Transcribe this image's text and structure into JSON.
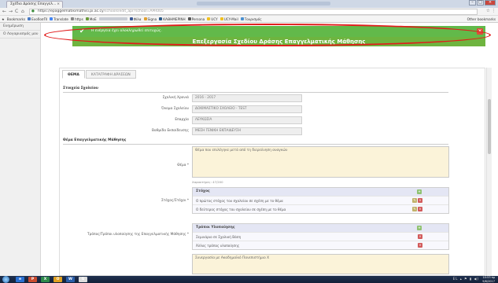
{
  "browser": {
    "tab_title": "Σχέδιο Δράσης Επαγγελ…",
    "tab_close": "×",
    "url_host": "https://epaggelmatikimathisi.pi.ac.cy",
    "url_rest": "/schools/edit_apr?school=APR005",
    "nav_back": "←",
    "nav_forward": "→",
    "nav_reload": "C",
    "nav_home": "⌂",
    "star_icon": "☆",
    "menu_icon": "⋮",
    "bookmarks_bar_label": "Bookmarks",
    "bookmarks": [
      {
        "label": "ΕυοδοσΠΙ",
        "color": "#4a7bc4"
      },
      {
        "label": "Translate",
        "color": "#4285f4"
      },
      {
        "label": "https",
        "color": "#888888"
      },
      {
        "label": "MoE",
        "color": "#6a9a3a"
      },
      {
        "label": "Φίλα",
        "color": "#3b5998"
      },
      {
        "label": "Signa",
        "color": "#e0a030"
      },
      {
        "label": "ΚΑΘΗΜΕΡΙΝΗ",
        "color": "#2a5a8a"
      },
      {
        "label": "Persona",
        "color": "#555555"
      },
      {
        "label": "UCY",
        "color": "#f0c020"
      },
      {
        "label": "UCY-Mail",
        "color": "#f0c020"
      },
      {
        "label": "Τουρισμός",
        "color": "#4a90d0"
      }
    ],
    "other_bookmarks": "Other bookmarks"
  },
  "sidebar": {
    "items": [
      {
        "label": "Ενημέρωση"
      },
      {
        "label": "Ο Λογαριασμός μου"
      }
    ]
  },
  "alert": {
    "message": "Η ενέργεια έχει ολοκληρωθεί επιτυχώς.",
    "check_icon": "✔",
    "close_icon": "✕",
    "color": "#62b94a"
  },
  "page": {
    "title": "Επεξεργασία Σχεδίου Δράσης Επαγγελματικής Μάθησης",
    "title_color": "#6eb43f"
  },
  "tabs": [
    {
      "label": "ΘΕΜΑ",
      "active": true
    },
    {
      "label": "ΚΑΤΑΓΡΑΦΗ ΔΡΑΣΕΩΝ",
      "active": false
    }
  ],
  "school_section": {
    "heading": "Στοιχεία Σχολείου",
    "fields": [
      {
        "label": "Σχολική Χρονιά",
        "value": "2016 - 2017"
      },
      {
        "label": "Όνομα Σχολείου",
        "value": "ΔΟΚΙΜΑΣΤΙΚΟ ΣΧΟΛΕΙΟ - TEST"
      },
      {
        "label": "Επαρχία",
        "value": "ΛΕΥΚΩΣΙΑ"
      },
      {
        "label": "Βαθμίδα Εκπαίδευσης",
        "value": "ΜΕΣΗ ΓΕΝΙΚΗ ΕΚΠΑΙΔΕΥΣΗ"
      }
    ]
  },
  "topic_section": {
    "heading": "Θέμα Επαγγελματικής Μάθησης",
    "topic_label": "Θέμα *",
    "topic_value": "Θέμα που επιλέγηκε μετά από τη διερεύνηση αναγκών",
    "char_counter": "Χαρακτήρες: 47/200",
    "goals": {
      "label": "Στόχος/Στόχοι *",
      "header": "Στόχος",
      "rows": [
        "Ο πρώτος στόχος του σχολείου σε σχέση με το θέμα",
        "Ο δεύτερος στόχος του σχολείου σε σχέση με το θέμα"
      ]
    },
    "methods": {
      "label": "Τρόπος/Τρόποι υλοποίησης της Επαγγελματικής Μάθησης *",
      "header": "Τρόποι Υλοποίησης",
      "rows": [
        "Σεμινάριο σε Σχολική Βάση",
        "Άλλος τρόπος υλοποίησης"
      ]
    },
    "collaboration_value": "Συνεργασία με Ακαδημαϊκό Πανεπιστήμιο Χ"
  },
  "taskbar": {
    "apps": [
      {
        "label": "e",
        "color": "#2a6fd0"
      },
      {
        "label": "P",
        "color": "#c94b2f"
      },
      {
        "label": "X",
        "color": "#2d8a4a"
      },
      {
        "label": "O",
        "color": "#e0a020"
      },
      {
        "label": "W",
        "color": "#2b5ea8"
      },
      {
        "label": "G",
        "color": "#dddddd"
      }
    ],
    "time": "10:53 πμ",
    "date": "9/6/2017",
    "tray": "EL ▴ ⚑ ▮ ◀)"
  }
}
